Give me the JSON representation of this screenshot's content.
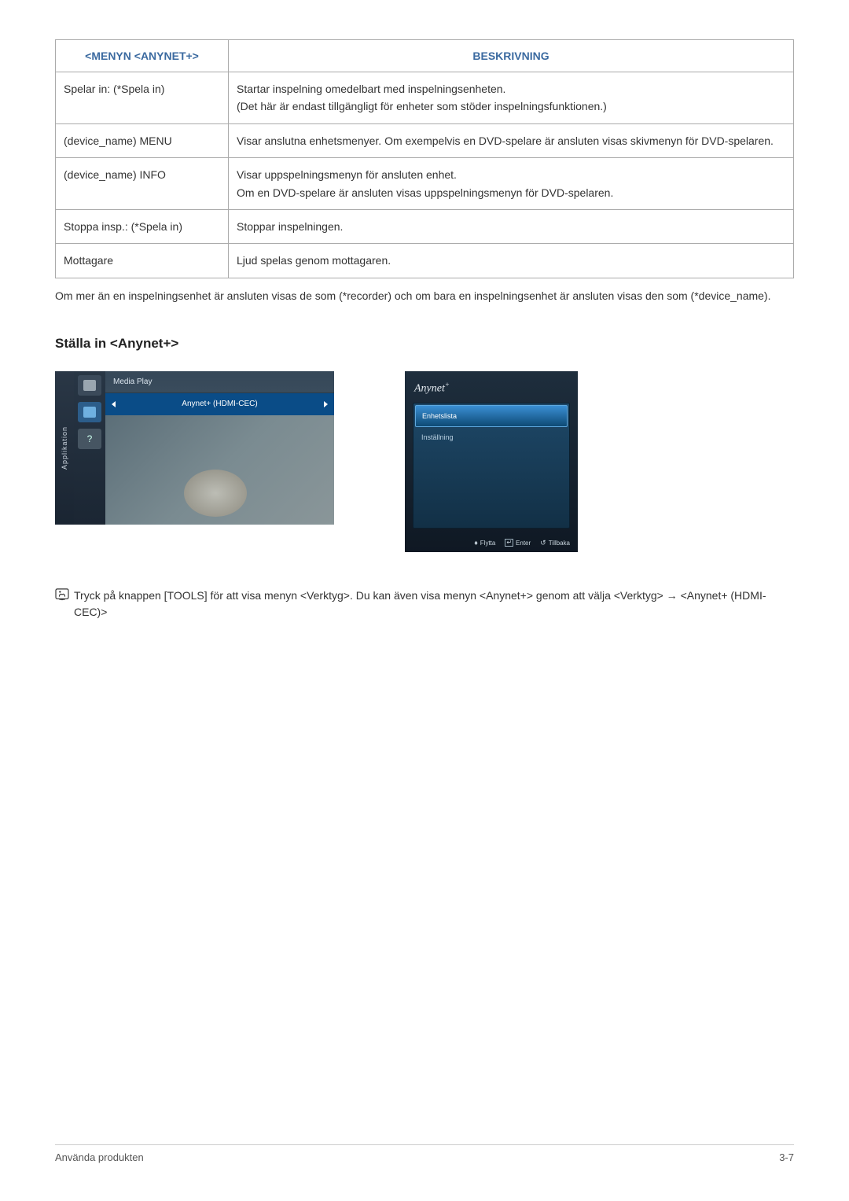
{
  "table": {
    "headers": {
      "col1": "<MENYN <ANYNET+>",
      "col2": "BESKRIVNING"
    },
    "rows": [
      {
        "name": "Spelar in: (*Spela in)",
        "desc": "Startar inspelning omedelbart med inspelningsenheten.\n(Det här är endast tillgängligt för enheter som stöder inspelningsfunktionen.)"
      },
      {
        "name": "(device_name) MENU",
        "desc": "Visar anslutna enhetsmenyer. Om exempelvis en DVD-spelare är ansluten visas skivmenyn för DVD-spelaren."
      },
      {
        "name": "(device_name) INFO",
        "desc": "Visar uppspelningsmenyn för ansluten enhet.\nOm en DVD-spelare är ansluten visas uppspelningsmenyn för DVD-spelaren."
      },
      {
        "name": "Stoppa insp.: (*Spela in)",
        "desc": "Stoppar inspelningen."
      },
      {
        "name": "Mottagare",
        "desc": "Ljud spelas genom mottagaren."
      }
    ]
  },
  "noteText": "Om mer än en inspelningsenhet är ansluten visas de som (*recorder) och om bara en inspelningsenhet är ansluten visas den som (*device_name).",
  "sectionHeading": "Ställa in <Anynet+>",
  "screen1": {
    "sidebar": "Applikation",
    "row1": "Media Play",
    "row2": "Anynet+ (HDMI-CEC)"
  },
  "screen2": {
    "logo": "Anynet",
    "item1": "Enhetslista",
    "item2": "Inställning",
    "foot1": "Flytta",
    "foot2": "Enter",
    "foot3": "Tillbaka"
  },
  "tipText": "Tryck på knappen [TOOLS] för att visa menyn <Verktyg>. Du kan även visa menyn <Anynet+> genom att välja <Verktyg> → <Anynet+ (HDMI-CEC)>",
  "footer": {
    "left": "Använda produkten",
    "right": "3-7"
  }
}
